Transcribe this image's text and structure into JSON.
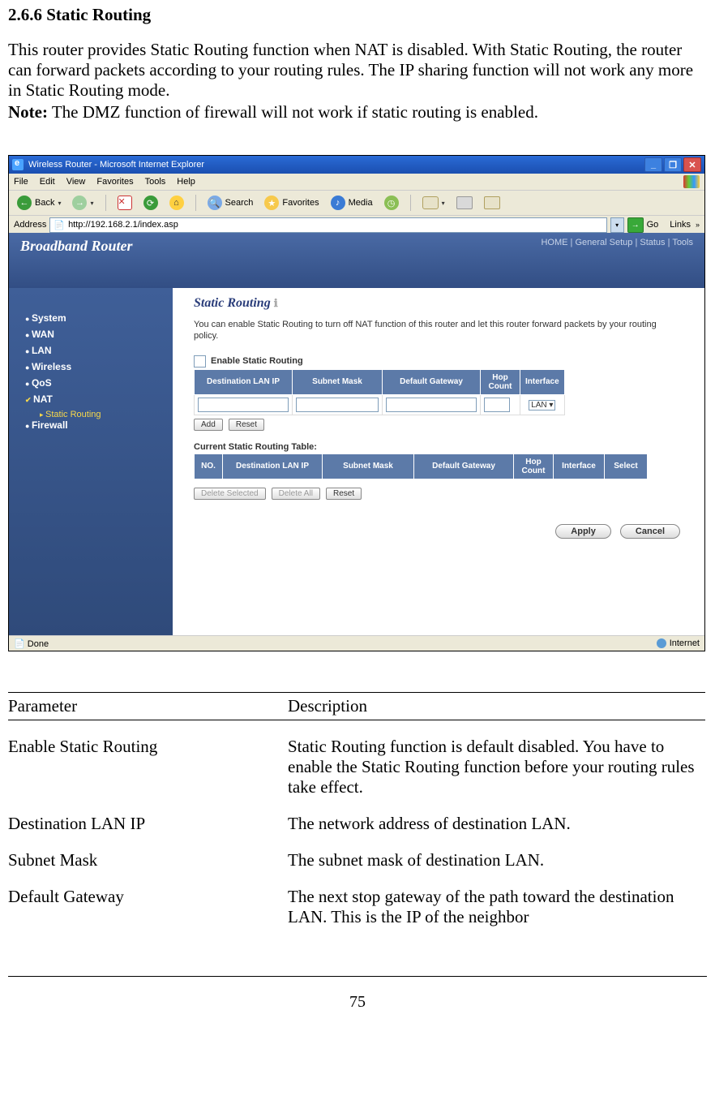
{
  "doc": {
    "heading": "2.6.6 Static Routing",
    "para1": "This router provides Static Routing function when NAT is disabled. With Static Routing, the router can forward packets according to your routing rules. The IP sharing function will not work any more in Static Routing mode.",
    "note_label": "Note:",
    "note_text": " The DMZ function of firewall will not work if static routing is enabled.",
    "page_number": "75"
  },
  "browser": {
    "title": "Wireless Router - Microsoft Internet Explorer",
    "menu": [
      "File",
      "Edit",
      "View",
      "Favorites",
      "Tools",
      "Help"
    ],
    "toolbar": {
      "back": "Back",
      "search": "Search",
      "favorites": "Favorites",
      "media": "Media"
    },
    "address_label": "Address",
    "address_value": "http://192.168.2.1/index.asp",
    "go": "Go",
    "links": "Links",
    "status_left": "Done",
    "status_right": "Internet"
  },
  "router": {
    "brand": "Broadband Router",
    "topnav": "HOME | General Setup | Status | Tools",
    "sidebar": {
      "items": [
        "System",
        "WAN",
        "LAN",
        "Wireless",
        "QoS",
        "NAT",
        "Firewall"
      ],
      "sublink": "Static Routing"
    },
    "page": {
      "title": "Static Routing",
      "desc": "You can enable Static Routing to turn off NAT function of this router and let this router forward packets by your routing policy.",
      "enable_label": "Enable Static Routing",
      "input_headers": [
        "Destination LAN IP",
        "Subnet Mask",
        "Default Gateway",
        "Hop Count",
        "Interface"
      ],
      "interface_value": "LAN",
      "add": "Add",
      "reset": "Reset",
      "table_title": "Current Static Routing Table:",
      "table_headers": [
        "NO.",
        "Destination LAN IP",
        "Subnet Mask",
        "Default Gateway",
        "Hop Count",
        "Interface",
        "Select"
      ],
      "delete_selected": "Delete Selected",
      "delete_all": "Delete All",
      "reset2": "Reset",
      "apply": "Apply",
      "cancel": "Cancel"
    }
  },
  "params": {
    "header_param": "Parameter",
    "header_desc": "Description",
    "rows": [
      {
        "p": "Enable Static Routing",
        "d": "Static Routing function is default disabled. You have to enable the Static Routing function before your routing rules take effect."
      },
      {
        "p": "Destination LAN IP",
        "d": "The network address of destination LAN."
      },
      {
        "p": "Subnet Mask",
        "d": "The subnet mask of destination LAN."
      },
      {
        "p": "Default Gateway",
        "d": "The next stop gateway of the path toward the destination LAN. This is the IP of the neighbor"
      }
    ]
  }
}
